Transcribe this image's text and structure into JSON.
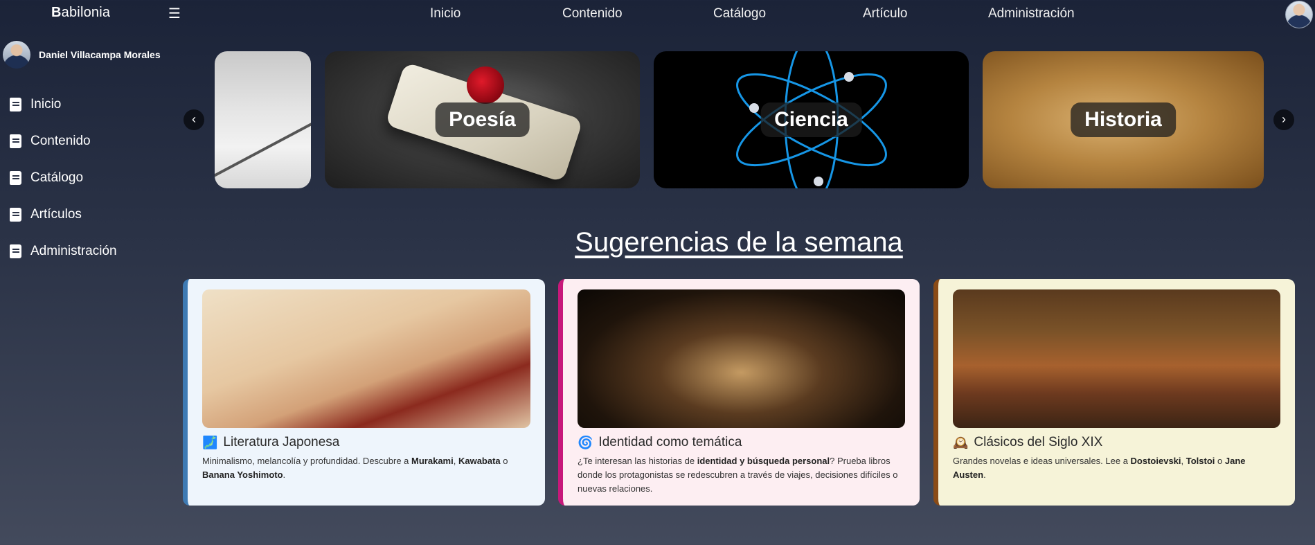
{
  "brand": {
    "first_letter": "B",
    "rest": "abilonia"
  },
  "menu_icon": "☰",
  "nav": {
    "items": [
      "Inicio",
      "Contenido",
      "Catálogo",
      "Artículo",
      "Administración"
    ]
  },
  "user": {
    "name": "Daniel Villacampa Morales"
  },
  "sidebar": {
    "items": [
      {
        "label": "Inicio",
        "icon": "book-icon"
      },
      {
        "label": "Contenido",
        "icon": "book-icon"
      },
      {
        "label": "Catálogo",
        "icon": "book-icon"
      },
      {
        "label": "Artículos",
        "icon": "book-icon"
      },
      {
        "label": "Administración",
        "icon": "book-icon"
      }
    ]
  },
  "carousel": {
    "prev": "‹",
    "next": "›",
    "slides": [
      {
        "title": "Poesía"
      },
      {
        "title": "Ciencia"
      },
      {
        "title": "Historia"
      }
    ]
  },
  "section": {
    "title": "Sugerencias de la semana"
  },
  "cards": [
    {
      "emoji": "🗾",
      "title": "Literatura Japonesa",
      "desc_prefix": "Minimalismo, melancolía y profundidad. Descubre a ",
      "b1": "Murakami",
      "sep1": ", ",
      "b2": "Kawabata",
      "sep2": " o ",
      "b3": "Banana Yoshimoto",
      "suffix": "."
    },
    {
      "emoji": "🌀",
      "title": "Identidad como temática",
      "desc_prefix": "¿Te interesan las historias de ",
      "b1": "identidad y búsqueda personal",
      "desc_suffix": "? Prueba libros donde los protagonistas se redescubren a través de viajes, decisiones difíciles o nuevas relaciones."
    },
    {
      "emoji": "🕰️",
      "title": "Clásicos del Siglo XIX",
      "desc_prefix": "Grandes novelas e ideas universales. Lee a ",
      "b1": "Dostoievski",
      "sep1": ", ",
      "b2": "Tolstoi",
      "sep2": " o ",
      "b3": "Jane Austen",
      "suffix": "."
    }
  ],
  "colors": {
    "card1_accent": "#3e7ab3",
    "card2_accent": "#c7187a",
    "card3_accent": "#8a4b16"
  }
}
